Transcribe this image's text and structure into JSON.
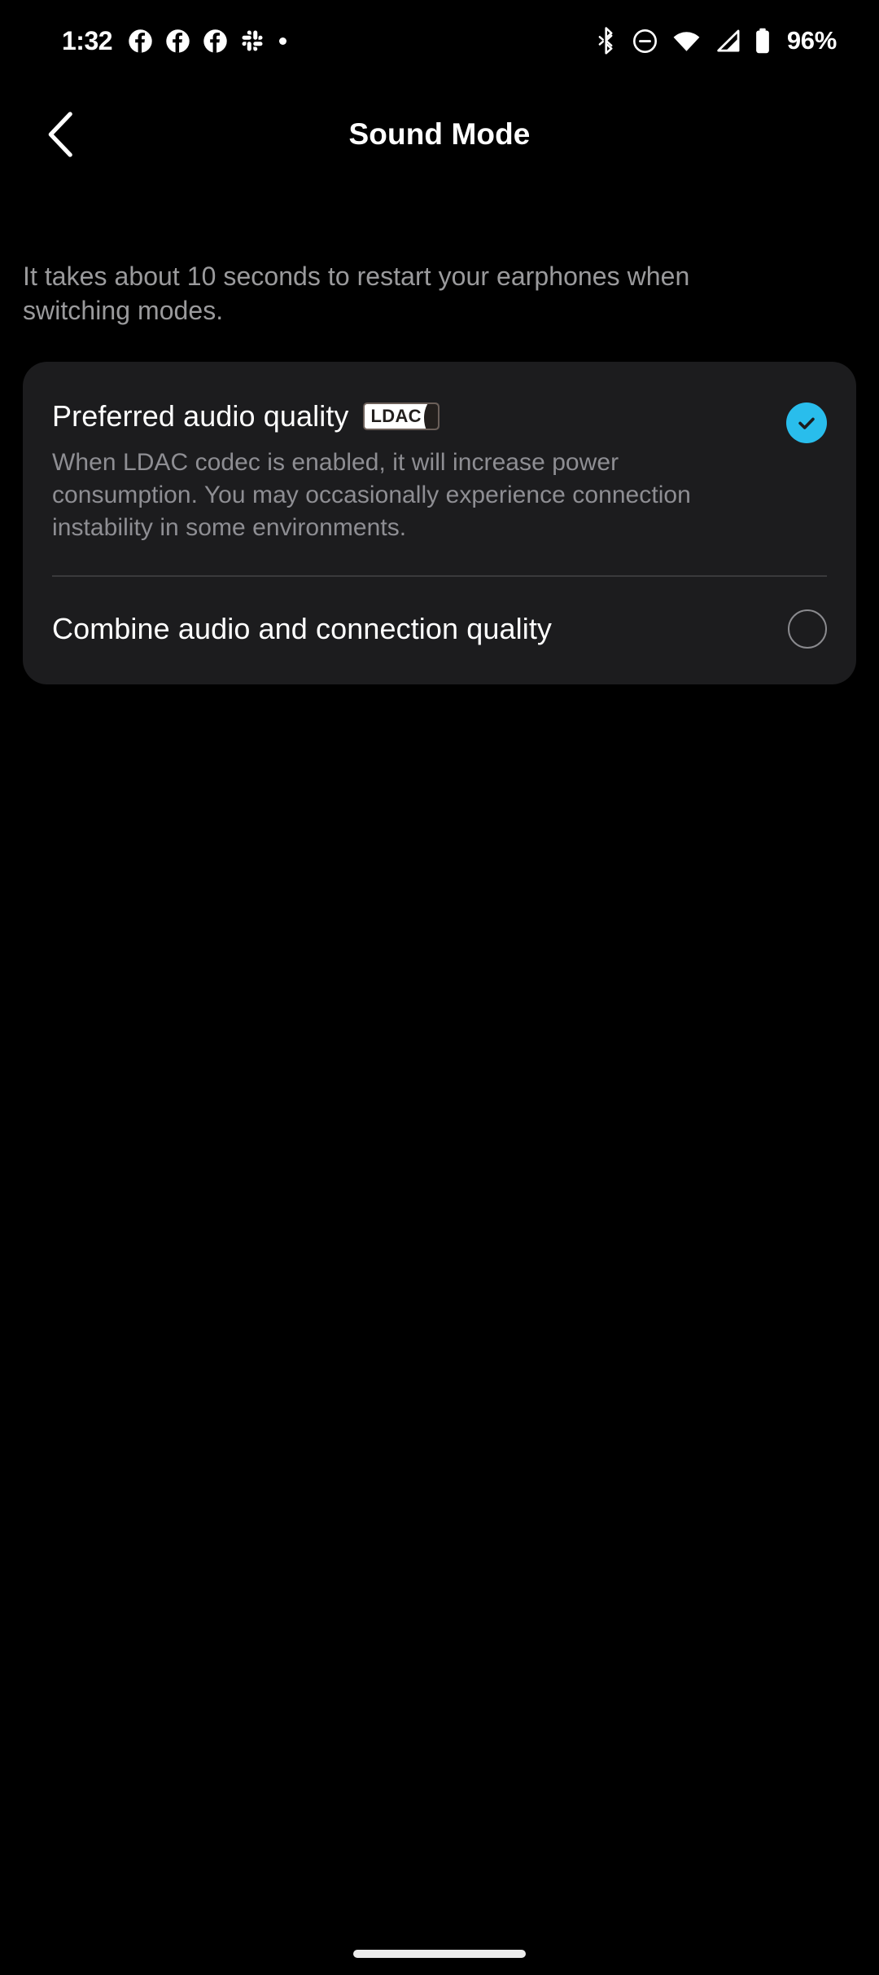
{
  "status_bar": {
    "time": "1:32",
    "battery_percent": "96%",
    "left_icons": [
      "facebook-icon",
      "facebook-icon",
      "facebook-icon",
      "slack-icon",
      "notification-dot-icon"
    ],
    "right_icons": [
      "bluetooth-icon",
      "do-not-disturb-icon",
      "wifi-icon",
      "cellular-signal-icon",
      "battery-icon"
    ]
  },
  "app_bar": {
    "back_icon": "chevron-left-icon",
    "title": "Sound Mode"
  },
  "intro_note": "It takes about 10 seconds to restart your earphones when switching modes.",
  "card": {
    "options": [
      {
        "title": "Preferred audio quality",
        "badge": "LDAC",
        "description": "When LDAC codec is enabled, it will increase power consumption. You may occasionally experience connection instability in some environments.",
        "selected": true,
        "control_icon": "check-circle-icon"
      },
      {
        "title": "Combine audio and connection quality",
        "selected": false,
        "control_icon": "radio-unselected-icon"
      }
    ]
  },
  "colors": {
    "background": "#000000",
    "card": "#1c1c1e",
    "accent": "#29bdec",
    "primary_text": "#ffffff",
    "secondary_text": "#8e8e93",
    "divider": "#3a3a3c"
  },
  "home_indicator": "home-indicator"
}
